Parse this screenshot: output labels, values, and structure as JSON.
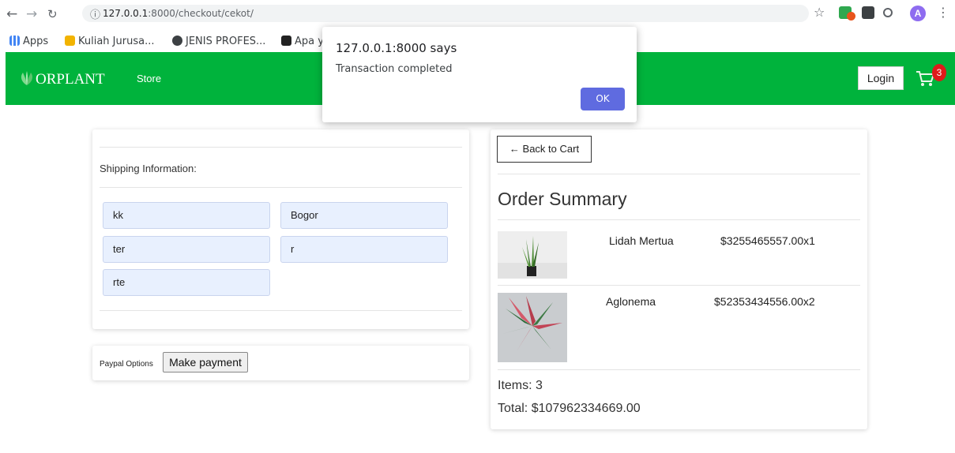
{
  "browser": {
    "url_host": "127.0.0.1",
    "url_rest": ":8000/checkout/cekot/",
    "bookmarks": [
      "Apps",
      "Kuliah Jurusa...",
      "JENIS PROFES...",
      "Apa y"
    ],
    "profile_initial": "A"
  },
  "navbar": {
    "brand": "ORPLANT",
    "store_link": "Store",
    "login_label": "Login",
    "cart_count": "3"
  },
  "shipping": {
    "heading": "Shipping Information:",
    "fields": [
      "kk",
      "Bogor",
      "ter",
      "r",
      "rte"
    ]
  },
  "payment": {
    "label": "Paypal Options",
    "button": "Make payment"
  },
  "summary": {
    "back_label": "← Back to Cart",
    "title": "Order Summary",
    "items": [
      {
        "name": "Lidah Mertua",
        "price": "$3255465557.00x1"
      },
      {
        "name": "Aglonema",
        "price": "$52353434556.00x2"
      }
    ],
    "items_text": "Items: 3",
    "total_text": "Total: $107962334669.00"
  },
  "dialog": {
    "title": "127.0.0.1:8000 says",
    "message": "Transaction completed",
    "ok_label": "OK"
  },
  "colors": {
    "navbar": "#00b33c",
    "cart_badge": "#e01a1a",
    "dialog_button": "#5f6be0",
    "input_fill": "#e8f0fe"
  }
}
